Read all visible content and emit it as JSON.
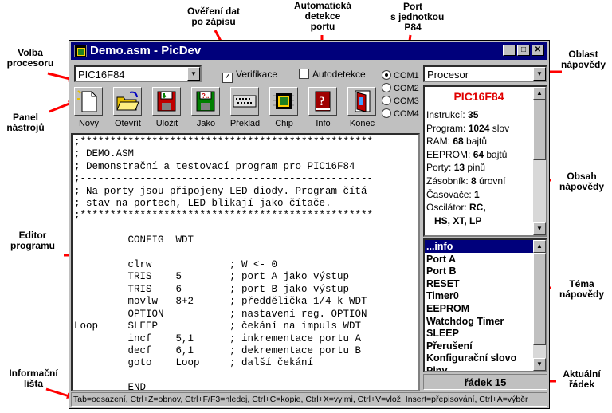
{
  "annotations": {
    "verify": "Ověření dat\npo zápisu",
    "autodetect": "Automatická\ndetekce\nportu",
    "port": "Port\ns jednotkou\nP84",
    "processor_select": "Volba\nprocesoru",
    "help_area": "Oblast\nnápovědy",
    "toolbar": "Panel\nnástrojů",
    "help_content": "Obsah\nnápovědy",
    "editor": "Editor\nprogramu",
    "help_topic": "Téma\nnápovědy",
    "status_bar": "Informační\nlišta",
    "current_line": "Aktuální\nřádek"
  },
  "window": {
    "title": "Demo.asm - PicDev",
    "minimize": "_",
    "maximize": "□",
    "close": "✕"
  },
  "processor_combo": {
    "value": "PIC16F84"
  },
  "verify_checkbox": {
    "label": "Verifikace",
    "checked": true,
    "mark": "✓"
  },
  "autodetect_checkbox": {
    "label": "Autodetekce",
    "checked": false
  },
  "ports": [
    {
      "label": "COM1",
      "selected": true
    },
    {
      "label": "COM2",
      "selected": false
    },
    {
      "label": "COM3",
      "selected": false
    },
    {
      "label": "COM4",
      "selected": false
    }
  ],
  "help_combo": {
    "value": "Procesor"
  },
  "toolbar": [
    {
      "label": "Nový",
      "icon": "new-file-icon"
    },
    {
      "label": "Otevřít",
      "icon": "open-folder-icon"
    },
    {
      "label": "Uložit",
      "icon": "save-disk-icon"
    },
    {
      "label": "Jako",
      "icon": "save-as-disk-icon"
    },
    {
      "label": "Překlad",
      "icon": "compile-icon"
    },
    {
      "label": "Chip",
      "icon": "chip-icon"
    },
    {
      "label": "Info",
      "icon": "info-book-icon"
    },
    {
      "label": "Konec",
      "icon": "exit-door-icon"
    }
  ],
  "editor": {
    "lines": [
      ";*************************************************",
      "; DEMO.ASM",
      "; Demonstrační a testovací program pro PIC16F84",
      ";-------------------------------------------------",
      "; Na porty jsou připojeny LED diody. Program čítá",
      "; stav na portech, LED blikají jako čítače.",
      ";*************************************************",
      "",
      "         CONFIG  WDT",
      "",
      "         clrw             ; W <- 0",
      "         TRIS    5        ; port A jako výstup",
      "         TRIS    6        ; port B jako výstup",
      "         movlw   8+2      ; předdělička 1/4 k WDT",
      "         OPTION           ; nastavení reg. OPTION",
      "Loop     SLEEP            ; čekání na impuls WDT",
      "         incf    5,1      ; inkrementace portu A",
      "         decf    6,1      ; dekrementace portu B",
      "         goto    Loop     ; další čekání",
      "",
      "         END"
    ]
  },
  "help": {
    "title": "PIC16F84",
    "rows": [
      {
        "label": "Instrukcí: ",
        "value": "35",
        "unit": ""
      },
      {
        "label": "Program: ",
        "value": "1024",
        "unit": " slov"
      },
      {
        "label": "RAM: ",
        "value": "68",
        "unit": " bajtů"
      },
      {
        "label": "EEPROM: ",
        "value": "64",
        "unit": " bajtů"
      },
      {
        "label": "Porty: ",
        "value": "13",
        "unit": " pinů"
      },
      {
        "label": "Zásobník: ",
        "value": "8",
        "unit": " úrovní"
      },
      {
        "label": "Časovače: ",
        "value": "1",
        "unit": ""
      },
      {
        "label": "Oscilátor: ",
        "value": "RC,",
        "unit": ""
      },
      {
        "label": "   ",
        "value": "HS, XT, LP",
        "unit": ""
      }
    ]
  },
  "topics": [
    {
      "label": "...info",
      "selected": true
    },
    {
      "label": "Port A",
      "selected": false
    },
    {
      "label": "Port B",
      "selected": false
    },
    {
      "label": "RESET",
      "selected": false
    },
    {
      "label": "Timer0",
      "selected": false
    },
    {
      "label": "EEPROM",
      "selected": false
    },
    {
      "label": "Watchdog Timer",
      "selected": false
    },
    {
      "label": "SLEEP",
      "selected": false
    },
    {
      "label": "Přerušení",
      "selected": false
    },
    {
      "label": "Konfigurační slovo",
      "selected": false
    },
    {
      "label": "Piny",
      "selected": false
    }
  ],
  "current_line": "řádek 15",
  "status": "Tab=odsazení, Ctrl+Z=obnov, Ctrl+F/F3=hledej, Ctrl+C=kopie, Ctrl+X=vyjmi, Ctrl+V=vlož, Insert=přepisování, Ctrl+A=výběr"
}
